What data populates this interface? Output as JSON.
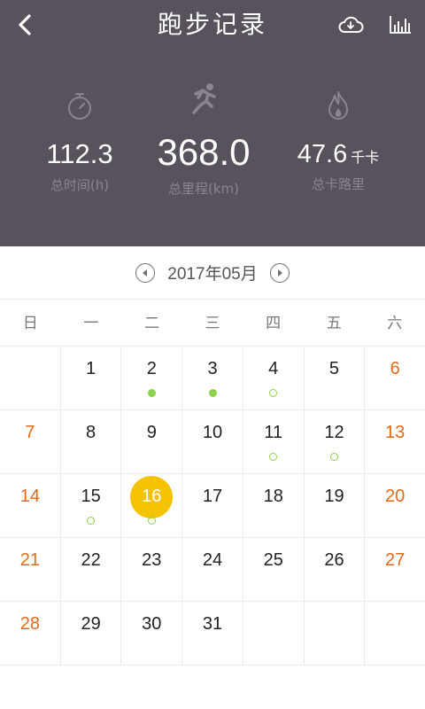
{
  "header": {
    "title": "跑步记录",
    "back_icon": "back-arrow-icon",
    "cloud_icon": "cloud-sync-icon",
    "chart_icon": "bar-chart-icon",
    "background": "#57525c"
  },
  "stats": {
    "time": {
      "value": "112.3",
      "label": "总时间(h)",
      "icon": "stopwatch-icon"
    },
    "distance": {
      "value": "368.0",
      "label": "总里程(km)",
      "icon": "runner-icon"
    },
    "calories": {
      "value": "47.6",
      "unit": "千卡",
      "label": "总卡路里",
      "icon": "flame-icon"
    }
  },
  "month": {
    "label": "2017年05月",
    "prev_icon": "prev-month-icon",
    "next_icon": "next-month-icon"
  },
  "weekdays": [
    "日",
    "一",
    "二",
    "三",
    "四",
    "五",
    "六"
  ],
  "colors": {
    "weekend": "#e06a1b",
    "today": "#f5c200",
    "run_dot": "#8ed14a"
  },
  "calendar": {
    "today": 16,
    "weeks": [
      [
        "",
        "1",
        "2",
        "3",
        "4",
        "5",
        "6"
      ],
      [
        "7",
        "8",
        "9",
        "10",
        "11",
        "12",
        "13"
      ],
      [
        "14",
        "15",
        "16",
        "17",
        "18",
        "19",
        "20"
      ],
      [
        "21",
        "22",
        "23",
        "24",
        "25",
        "26",
        "27"
      ],
      [
        "28",
        "29",
        "30",
        "31",
        "",
        "",
        ""
      ]
    ],
    "markers": {
      "2": "filled",
      "3": "filled",
      "4": "hollow",
      "11": "hollow",
      "12": "hollow",
      "15": "hollow",
      "16": "hollow"
    }
  }
}
